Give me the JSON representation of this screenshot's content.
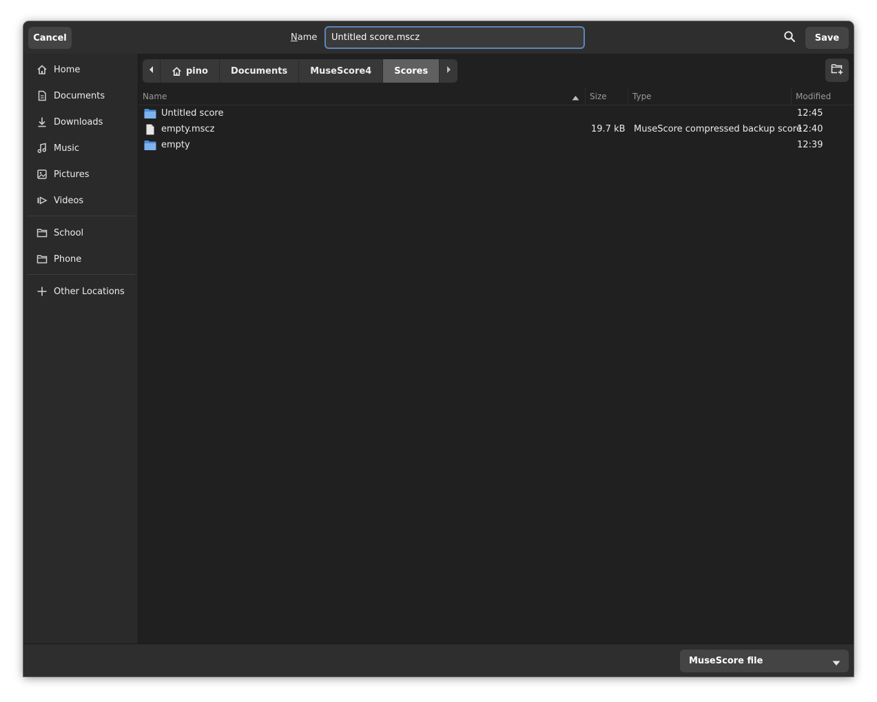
{
  "header": {
    "cancel_label": "Cancel",
    "name_label_first": "N",
    "name_label_rest": "ame",
    "name_value": "Untitled score.mscz",
    "save_label": "Save",
    "search_icon": "search-icon"
  },
  "sidebar": {
    "items": [
      {
        "label": "Home",
        "icon": "home-icon"
      },
      {
        "label": "Documents",
        "icon": "document-icon"
      },
      {
        "label": "Downloads",
        "icon": "download-icon"
      },
      {
        "label": "Music",
        "icon": "music-icon"
      },
      {
        "label": "Pictures",
        "icon": "picture-icon"
      },
      {
        "label": "Videos",
        "icon": "video-icon"
      },
      {
        "label": "School",
        "icon": "folder-icon"
      },
      {
        "label": "Phone",
        "icon": "folder-icon"
      },
      {
        "label": "Other Locations",
        "icon": "plus-icon"
      }
    ]
  },
  "pathbar": {
    "crumbs": [
      "pino",
      "Documents",
      "MuseScore4",
      "Scores"
    ],
    "active": "Scores"
  },
  "filelist": {
    "columns": [
      "Name",
      "Size",
      "Type",
      "Modified"
    ],
    "sorted_by": "Name",
    "rows": [
      {
        "name": "Untitled score",
        "kind": "folder",
        "size": "",
        "type": "",
        "modified": "12:45"
      },
      {
        "name": "empty.mscz",
        "kind": "file",
        "size": "19.7 kB",
        "type": "MuseScore compressed backup score",
        "modified": "12:40"
      },
      {
        "name": "empty",
        "kind": "folder",
        "size": "",
        "type": "",
        "modified": "12:39"
      }
    ]
  },
  "footer": {
    "filter_value": "MuseScore file"
  },
  "colors": {
    "window_bg": "#202020",
    "header_bg": "#2e2e2e",
    "sidebar_bg": "#2a2a2a",
    "input_focus": "#5f87b7",
    "folder_blue": "#6aa5e8"
  }
}
